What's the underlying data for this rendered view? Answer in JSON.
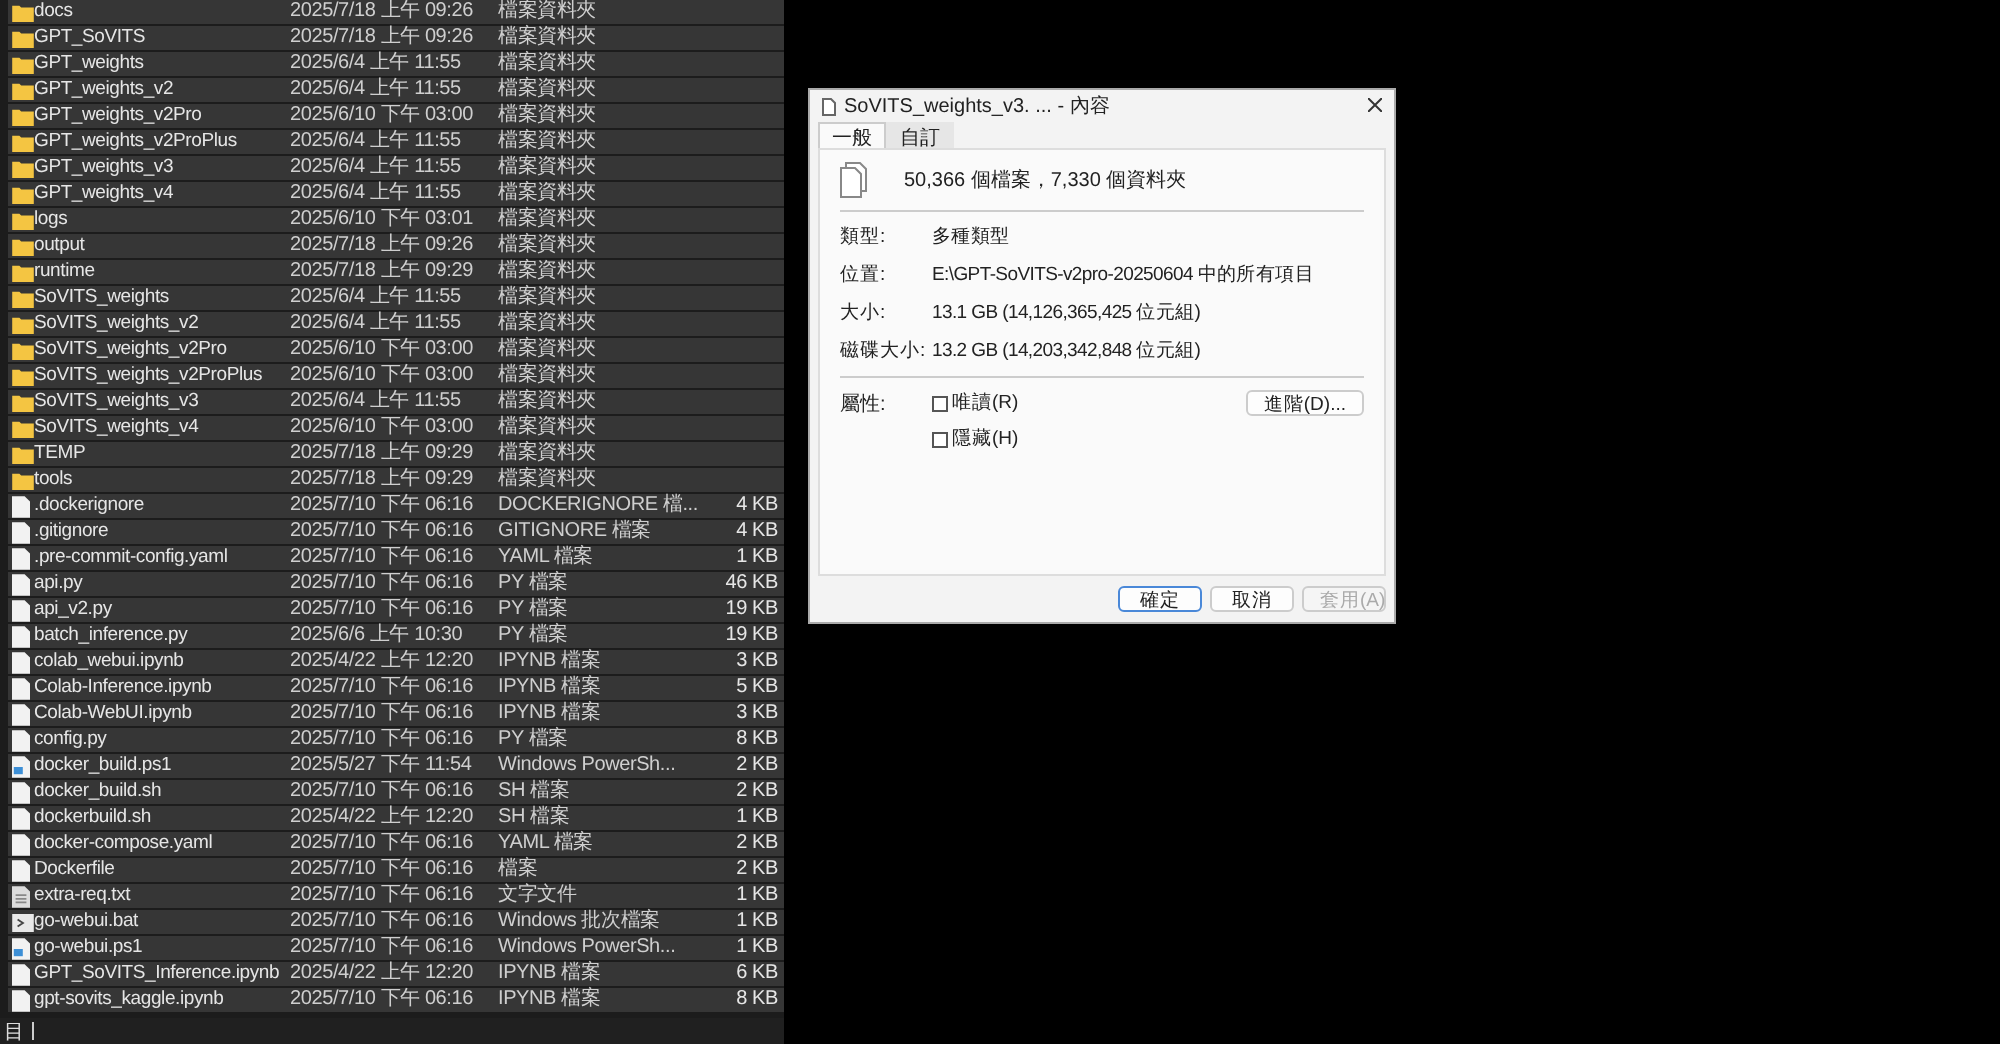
{
  "files": [
    {
      "kind": "folder",
      "name": "docs",
      "date": "2025/7/18 上午 09:26",
      "type": "檔案資料夾",
      "selected": true
    },
    {
      "kind": "folder",
      "name": "GPT_SoVITS",
      "date": "2025/7/18 上午 09:26",
      "type": "檔案資料夾",
      "selected": true
    },
    {
      "kind": "folder",
      "name": "GPT_weights",
      "date": "2025/6/4 上午 11:55",
      "type": "檔案資料夾",
      "selected": true
    },
    {
      "kind": "folder",
      "name": "GPT_weights_v2",
      "date": "2025/6/4 上午 11:55",
      "type": "檔案資料夾",
      "selected": true
    },
    {
      "kind": "folder",
      "name": "GPT_weights_v2Pro",
      "date": "2025/6/10 下午 03:00",
      "type": "檔案資料夾",
      "selected": true
    },
    {
      "kind": "folder",
      "name": "GPT_weights_v2ProPlus",
      "date": "2025/6/4 上午 11:55",
      "type": "檔案資料夾",
      "selected": true
    },
    {
      "kind": "folder",
      "name": "GPT_weights_v3",
      "date": "2025/6/4 上午 11:55",
      "type": "檔案資料夾",
      "selected": true
    },
    {
      "kind": "folder",
      "name": "GPT_weights_v4",
      "date": "2025/6/4 上午 11:55",
      "type": "檔案資料夾",
      "selected": true
    },
    {
      "kind": "folder",
      "name": "logs",
      "date": "2025/6/10 下午 03:01",
      "type": "檔案資料夾",
      "selected": true
    },
    {
      "kind": "folder",
      "name": "output",
      "date": "2025/7/18 上午 09:26",
      "type": "檔案資料夾",
      "selected": true
    },
    {
      "kind": "folder",
      "name": "runtime",
      "date": "2025/7/18 上午 09:29",
      "type": "檔案資料夾",
      "selected": true
    },
    {
      "kind": "folder",
      "name": "SoVITS_weights",
      "date": "2025/6/4 上午 11:55",
      "type": "檔案資料夾",
      "selected": true
    },
    {
      "kind": "folder",
      "name": "SoVITS_weights_v2",
      "date": "2025/6/4 上午 11:55",
      "type": "檔案資料夾",
      "selected": true
    },
    {
      "kind": "folder",
      "name": "SoVITS_weights_v2Pro",
      "date": "2025/6/10 下午 03:00",
      "type": "檔案資料夾",
      "selected": true
    },
    {
      "kind": "folder",
      "name": "SoVITS_weights_v2ProPlus",
      "date": "2025/6/10 下午 03:00",
      "type": "檔案資料夾",
      "selected": true
    },
    {
      "kind": "folder",
      "name": "SoVITS_weights_v3",
      "date": "2025/6/4 上午 11:55",
      "type": "檔案資料夾",
      "selected": true
    },
    {
      "kind": "folder",
      "name": "SoVITS_weights_v4",
      "date": "2025/6/10 下午 03:00",
      "type": "檔案資料夾",
      "selected": true
    },
    {
      "kind": "folder",
      "name": "TEMP",
      "date": "2025/7/18 上午 09:29",
      "type": "檔案資料夾",
      "selected": true
    },
    {
      "kind": "folder",
      "name": "tools",
      "date": "2025/7/18 上午 09:29",
      "type": "檔案資料夾",
      "selected": true
    },
    {
      "kind": "file",
      "name": ".dockerignore",
      "date": "2025/7/10 下午 06:16",
      "type": "DOCKERIGNORE 檔...",
      "size": "4 KB",
      "selected": true
    },
    {
      "kind": "file",
      "name": ".gitignore",
      "date": "2025/7/10 下午 06:16",
      "type": "GITIGNORE 檔案",
      "size": "4 KB",
      "selected": true
    },
    {
      "kind": "file",
      "name": ".pre-commit-config.yaml",
      "date": "2025/7/10 下午 06:16",
      "type": "YAML 檔案",
      "size": "1 KB",
      "selected": true
    },
    {
      "kind": "file",
      "name": "api.py",
      "date": "2025/7/10 下午 06:16",
      "type": "PY 檔案",
      "size": "46 KB",
      "selected": true
    },
    {
      "kind": "file",
      "name": "api_v2.py",
      "date": "2025/7/10 下午 06:16",
      "type": "PY 檔案",
      "size": "19 KB",
      "selected": true
    },
    {
      "kind": "file",
      "name": "batch_inference.py",
      "date": "2025/6/6 上午 10:30",
      "type": "PY 檔案",
      "size": "19 KB",
      "selected": true
    },
    {
      "kind": "file",
      "name": "colab_webui.ipynb",
      "date": "2025/4/22 上午 12:20",
      "type": "IPYNB 檔案",
      "size": "3 KB",
      "selected": true
    },
    {
      "kind": "file",
      "name": "Colab-Inference.ipynb",
      "date": "2025/7/10 下午 06:16",
      "type": "IPYNB 檔案",
      "size": "5 KB",
      "selected": true
    },
    {
      "kind": "file",
      "name": "Colab-WebUI.ipynb",
      "date": "2025/7/10 下午 06:16",
      "type": "IPYNB 檔案",
      "size": "3 KB",
      "selected": true
    },
    {
      "kind": "file",
      "name": "config.py",
      "date": "2025/7/10 下午 06:16",
      "type": "PY 檔案",
      "size": "8 KB",
      "selected": true
    },
    {
      "kind": "script",
      "name": "docker_build.ps1",
      "date": "2025/5/27 下午 11:54",
      "type": "Windows PowerSh...",
      "size": "2 KB",
      "selected": true
    },
    {
      "kind": "file",
      "name": "docker_build.sh",
      "date": "2025/7/10 下午 06:16",
      "type": "SH 檔案",
      "size": "2 KB",
      "selected": true
    },
    {
      "kind": "file",
      "name": "dockerbuild.sh",
      "date": "2025/4/22 上午 12:20",
      "type": "SH 檔案",
      "size": "1 KB",
      "selected": true
    },
    {
      "kind": "file",
      "name": "docker-compose.yaml",
      "date": "2025/7/10 下午 06:16",
      "type": "YAML 檔案",
      "size": "2 KB",
      "selected": true
    },
    {
      "kind": "file",
      "name": "Dockerfile",
      "date": "2025/7/10 下午 06:16",
      "type": "檔案",
      "size": "2 KB",
      "selected": true
    },
    {
      "kind": "text",
      "name": "extra-req.txt",
      "date": "2025/7/10 下午 06:16",
      "type": "文字文件",
      "size": "1 KB",
      "selected": true
    },
    {
      "kind": "batch",
      "name": "go-webui.bat",
      "date": "2025/7/10 下午 06:16",
      "type": "Windows 批次檔案",
      "size": "1 KB",
      "selected": true
    },
    {
      "kind": "script",
      "name": "go-webui.ps1",
      "date": "2025/7/10 下午 06:16",
      "type": "Windows PowerSh...",
      "size": "1 KB",
      "selected": true
    },
    {
      "kind": "file",
      "name": "GPT_SoVITS_Inference.ipynb",
      "date": "2025/4/22 上午 12:20",
      "type": "IPYNB 檔案",
      "size": "6 KB",
      "selected": true
    },
    {
      "kind": "file",
      "name": "gpt-sovits_kaggle.ipynb",
      "date": "2025/7/10 下午 06:16",
      "type": "IPYNB 檔案",
      "size": "8 KB",
      "selected": true
    }
  ],
  "status_bar": {
    "text": "目"
  },
  "dialog": {
    "title": "SoVITS_weights_v3. ... - 內容",
    "tabs": [
      {
        "label": "一般",
        "selected": true
      },
      {
        "label": "自訂",
        "selected": false
      }
    ],
    "summary": "50,366 個檔案，7,330 個資料夾",
    "properties": [
      {
        "label": "類型:",
        "value": "多種類型"
      },
      {
        "label": "位置:",
        "value": "E:\\GPT-SoVITS-v2pro-20250604 中的所有項目"
      },
      {
        "label": "大小:",
        "value": "13.1 GB (14,126,365,425 位元組)"
      },
      {
        "label": "磁碟大小:",
        "value": "13.2 GB (14,203,342,848 位元組)"
      }
    ],
    "attributes_label": "屬性:",
    "attributes": [
      {
        "label": "唯讀(R)",
        "checked": false
      },
      {
        "label": "隱藏(H)",
        "checked": false
      }
    ],
    "advanced_button": "進階(D)...",
    "buttons": [
      {
        "label": "確定",
        "kind": "default",
        "disabled": false
      },
      {
        "label": "取消",
        "kind": "normal",
        "disabled": false
      },
      {
        "label": "套用(A)",
        "kind": "normal",
        "disabled": true
      }
    ]
  }
}
